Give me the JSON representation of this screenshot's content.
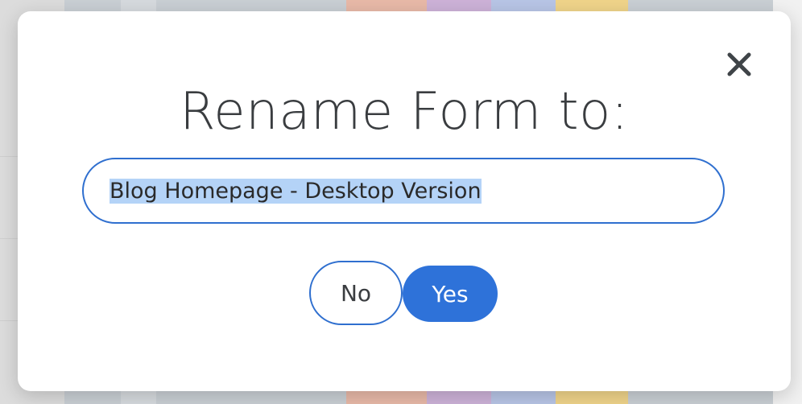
{
  "dialog": {
    "title": "Rename Form to:",
    "input_value": "Blog Homepage - Desktop Version",
    "no_label": "No",
    "yes_label": "Yes",
    "close_icon": "close-icon"
  },
  "colors": {
    "accent": "#2e72d9",
    "border": "#2f6fcf",
    "title_text": "#3a3d40",
    "selection": "#b4d3f7"
  }
}
